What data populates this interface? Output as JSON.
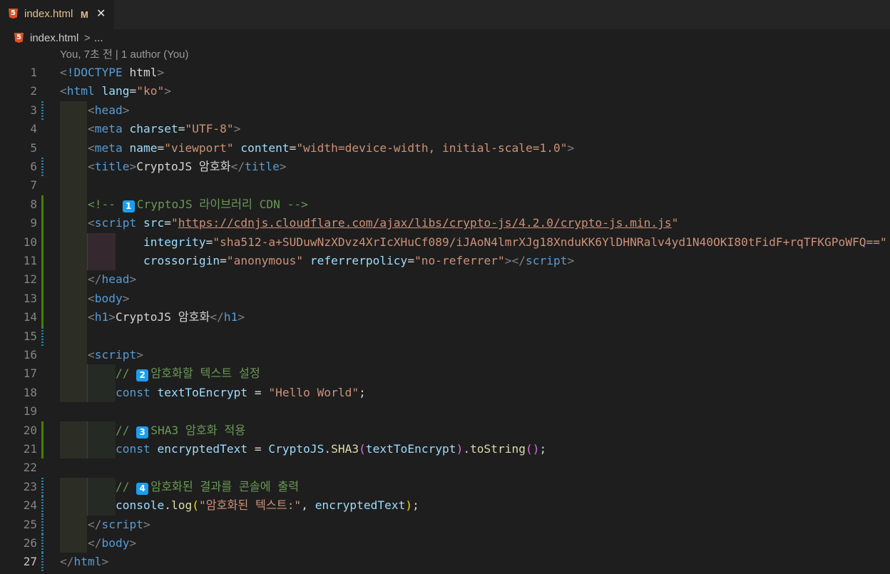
{
  "tab": {
    "title": "index.html",
    "status": "M",
    "close": "✕",
    "icon": "html5-icon"
  },
  "breadcrumb": {
    "file": "index.html",
    "separator": ">",
    "more": "..."
  },
  "blame": "You, 7초 전 | 1 author (You)",
  "colors": {
    "gutter_modified": "#1b81a8",
    "gutter_added": "#487e02"
  },
  "lines": [
    {
      "n": "1",
      "gutter": "",
      "indent": 0,
      "tokens": [
        [
          "punc",
          "<"
        ],
        [
          "tag",
          "!DOCTYPE "
        ],
        [
          "txt",
          "html"
        ],
        [
          "punc",
          ">"
        ]
      ]
    },
    {
      "n": "2",
      "gutter": "",
      "indent": 0,
      "tokens": [
        [
          "punc",
          "<"
        ],
        [
          "tag",
          "html "
        ],
        [
          "attr",
          "lang"
        ],
        [
          "txt",
          "="
        ],
        [
          "str",
          "\"ko\""
        ],
        [
          "punc",
          ">"
        ]
      ]
    },
    {
      "n": "3",
      "gutter": "mod",
      "indent": 1,
      "tokens": [
        [
          "txt",
          "    "
        ],
        [
          "punc",
          "<"
        ],
        [
          "tag",
          "head"
        ],
        [
          "punc",
          ">"
        ]
      ]
    },
    {
      "n": "4",
      "gutter": "",
      "indent": 1,
      "tokens": [
        [
          "txt",
          "    "
        ],
        [
          "punc",
          "<"
        ],
        [
          "tag",
          "meta "
        ],
        [
          "attr",
          "charset"
        ],
        [
          "txt",
          "="
        ],
        [
          "str",
          "\"UTF-8\""
        ],
        [
          "punc",
          ">"
        ]
      ]
    },
    {
      "n": "5",
      "gutter": "",
      "indent": 1,
      "tokens": [
        [
          "txt",
          "    "
        ],
        [
          "punc",
          "<"
        ],
        [
          "tag",
          "meta "
        ],
        [
          "attr",
          "name"
        ],
        [
          "txt",
          "="
        ],
        [
          "str",
          "\"viewport\" "
        ],
        [
          "attr",
          "content"
        ],
        [
          "txt",
          "="
        ],
        [
          "str",
          "\"width=device-width, initial-scale=1.0\""
        ],
        [
          "punc",
          ">"
        ]
      ]
    },
    {
      "n": "6",
      "gutter": "mod",
      "indent": 1,
      "tokens": [
        [
          "txt",
          "    "
        ],
        [
          "punc",
          "<"
        ],
        [
          "tag",
          "title"
        ],
        [
          "punc",
          ">"
        ],
        [
          "txt",
          "CryptoJS 암호화"
        ],
        [
          "punc",
          "</"
        ],
        [
          "tag",
          "title"
        ],
        [
          "punc",
          ">"
        ]
      ]
    },
    {
      "n": "7",
      "gutter": "",
      "indent": 1,
      "tokens": []
    },
    {
      "n": "8",
      "gutter": "add",
      "indent": 1,
      "tokens": [
        [
          "txt",
          "    "
        ],
        [
          "com",
          "<!-- "
        ],
        [
          "badge",
          "1"
        ],
        [
          "com",
          "CryptoJS 라이브러리 CDN -->"
        ]
      ]
    },
    {
      "n": "9",
      "gutter": "add",
      "indent": 1,
      "tokens": [
        [
          "txt",
          "    "
        ],
        [
          "punc",
          "<"
        ],
        [
          "tag",
          "script "
        ],
        [
          "attr",
          "src"
        ],
        [
          "txt",
          "="
        ],
        [
          "str",
          "\""
        ],
        [
          "link",
          "https://cdnjs.cloudflare.com/ajax/libs/crypto-js/4.2.0/crypto-js.min.js"
        ],
        [
          "str",
          "\""
        ]
      ]
    },
    {
      "n": "10",
      "gutter": "add",
      "indent": 2,
      "tokens": [
        [
          "txt",
          "            "
        ],
        [
          "attr",
          "integrity"
        ],
        [
          "txt",
          "="
        ],
        [
          "str",
          "\"sha512-a+SUDuwNzXDvz4XrIcXHuCf089/iJAoN4lmrXJg18XnduKK6YlDHNRalv4yd1N40OKI80tFidF+rqTFKGPoWFQ==\""
        ]
      ]
    },
    {
      "n": "11",
      "gutter": "add",
      "indent": 2,
      "tokens": [
        [
          "txt",
          "            "
        ],
        [
          "attr",
          "crossorigin"
        ],
        [
          "txt",
          "="
        ],
        [
          "str",
          "\"anonymous\" "
        ],
        [
          "attr",
          "referrerpolicy"
        ],
        [
          "txt",
          "="
        ],
        [
          "str",
          "\"no-referrer\""
        ],
        [
          "punc",
          "></"
        ],
        [
          "tag",
          "script"
        ],
        [
          "punc",
          ">"
        ]
      ]
    },
    {
      "n": "12",
      "gutter": "add",
      "indent": 1,
      "tokens": [
        [
          "txt",
          "    "
        ],
        [
          "punc",
          "</"
        ],
        [
          "tag",
          "head"
        ],
        [
          "punc",
          ">"
        ]
      ]
    },
    {
      "n": "13",
      "gutter": "add",
      "indent": 1,
      "tokens": [
        [
          "txt",
          "    "
        ],
        [
          "punc",
          "<"
        ],
        [
          "tag",
          "body"
        ],
        [
          "punc",
          ">"
        ]
      ]
    },
    {
      "n": "14",
      "gutter": "add",
      "indent": 1,
      "tokens": [
        [
          "txt",
          "    "
        ],
        [
          "punc",
          "<"
        ],
        [
          "tag",
          "h1"
        ],
        [
          "punc",
          ">"
        ],
        [
          "txt",
          "CryptoJS 암호화"
        ],
        [
          "punc",
          "</"
        ],
        [
          "tag",
          "h1"
        ],
        [
          "punc",
          ">"
        ]
      ]
    },
    {
      "n": "15",
      "gutter": "mod",
      "indent": 1,
      "tokens": []
    },
    {
      "n": "16",
      "gutter": "",
      "indent": 1,
      "tokens": [
        [
          "txt",
          "    "
        ],
        [
          "punc",
          "<"
        ],
        [
          "tag",
          "script"
        ],
        [
          "punc",
          ">"
        ]
      ]
    },
    {
      "n": "17",
      "gutter": "",
      "indent": 2,
      "tokens": [
        [
          "txt",
          "        "
        ],
        [
          "com",
          "// "
        ],
        [
          "badge",
          "2"
        ],
        [
          "com",
          "암호화할 텍스트 설정"
        ]
      ]
    },
    {
      "n": "18",
      "gutter": "",
      "indent": 2,
      "tokens": [
        [
          "txt",
          "        "
        ],
        [
          "kw",
          "const "
        ],
        [
          "var",
          "textToEncrypt"
        ],
        [
          "txt",
          " = "
        ],
        [
          "str",
          "\"Hello World\""
        ],
        [
          "txt",
          ";"
        ]
      ]
    },
    {
      "n": "19",
      "gutter": "",
      "indent": 0,
      "tokens": []
    },
    {
      "n": "20",
      "gutter": "add",
      "indent": 2,
      "tokens": [
        [
          "txt",
          "        "
        ],
        [
          "com",
          "// "
        ],
        [
          "badge",
          "3"
        ],
        [
          "com",
          "SHA3 암호화 적용"
        ]
      ]
    },
    {
      "n": "21",
      "gutter": "add",
      "indent": 2,
      "tokens": [
        [
          "txt",
          "        "
        ],
        [
          "kw",
          "const "
        ],
        [
          "var",
          "encryptedText"
        ],
        [
          "txt",
          " = "
        ],
        [
          "var",
          "CryptoJS"
        ],
        [
          "txt",
          "."
        ],
        [
          "fn",
          "SHA3"
        ],
        [
          "brk2",
          "("
        ],
        [
          "var",
          "textToEncrypt"
        ],
        [
          "brk2",
          ")"
        ],
        [
          "txt",
          "."
        ],
        [
          "fn",
          "toString"
        ],
        [
          "brk2",
          "()"
        ],
        [
          "txt",
          ";"
        ]
      ]
    },
    {
      "n": "22",
      "gutter": "",
      "indent": 0,
      "tokens": []
    },
    {
      "n": "23",
      "gutter": "mod",
      "indent": 2,
      "tokens": [
        [
          "txt",
          "        "
        ],
        [
          "com",
          "// "
        ],
        [
          "badge",
          "4"
        ],
        [
          "com",
          "암호화된 결과를 콘솔에 출력"
        ]
      ]
    },
    {
      "n": "24",
      "gutter": "mod",
      "indent": 2,
      "tokens": [
        [
          "txt",
          "        "
        ],
        [
          "var",
          "console"
        ],
        [
          "txt",
          "."
        ],
        [
          "fn",
          "log"
        ],
        [
          "brk",
          "("
        ],
        [
          "str",
          "\"암호화된 텍스트:\""
        ],
        [
          "txt",
          ", "
        ],
        [
          "var",
          "encryptedText"
        ],
        [
          "brk",
          ")"
        ],
        [
          "txt",
          ";"
        ]
      ]
    },
    {
      "n": "25",
      "gutter": "mod",
      "indent": 1,
      "tokens": [
        [
          "txt",
          "    "
        ],
        [
          "punc",
          "</"
        ],
        [
          "tag",
          "script"
        ],
        [
          "punc",
          ">"
        ]
      ]
    },
    {
      "n": "26",
      "gutter": "mod",
      "indent": 1,
      "tokens": [
        [
          "txt",
          "    "
        ],
        [
          "punc",
          "</"
        ],
        [
          "tag",
          "body"
        ],
        [
          "punc",
          ">"
        ]
      ]
    },
    {
      "n": "27",
      "gutter": "mod",
      "indent": 0,
      "tokens": [
        [
          "punc",
          "</"
        ],
        [
          "tag",
          "html"
        ],
        [
          "punc",
          ">"
        ]
      ]
    }
  ]
}
